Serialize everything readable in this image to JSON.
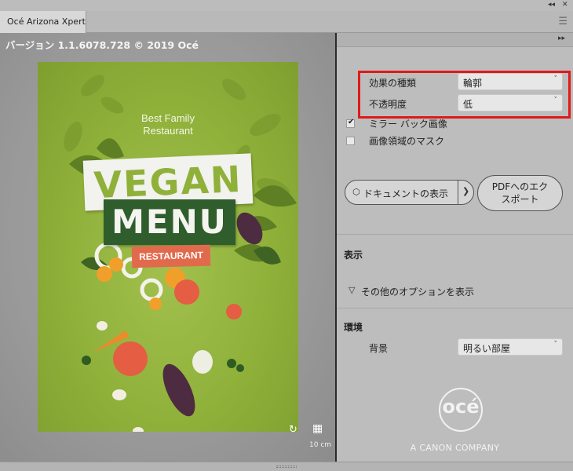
{
  "window": {
    "tab_title": "Océ Arizona Xpert",
    "collapse_icon": "double-chevron-left",
    "close_icon": "close",
    "menu_icon": "hamburger"
  },
  "preview": {
    "version_text": "バージョン 1.1.6078.728 © 2019 Océ",
    "poster": {
      "subtitle_line1": "Best Family",
      "subtitle_line2": "Restaurant",
      "title_word1": "VEGAN",
      "title_word2": "MENU",
      "tag": "RESTAURANT"
    },
    "rotate_icon": "rotate",
    "grid_icon": "grid",
    "scale_label": "10 cm"
  },
  "settings": {
    "effect_type": {
      "label": "効果の種類",
      "value": "輪郭"
    },
    "opacity": {
      "label": "不透明度",
      "value": "低"
    },
    "mirror_backlit": {
      "label": "ミラー バック画像",
      "checked": true
    },
    "mask_image_area": {
      "label": "画像領域のマスク",
      "checked": false
    },
    "show_document_button": "ドキュメントの表示",
    "export_pdf_button_line1": "PDFへのエク",
    "export_pdf_button_line2": "スポート"
  },
  "display": {
    "title": "表示",
    "more_options": "その他のオプションを表示"
  },
  "environment": {
    "title": "環境",
    "background_label": "背景",
    "background_value": "明るい部屋"
  },
  "branding": {
    "logo_text": "océ",
    "tagline": "A CANON COMPANY"
  },
  "colors": {
    "highlight": "#e11919",
    "poster_green": "#8fb13a",
    "menu_green": "#2f5d2c",
    "tag_red": "#e26a4c"
  }
}
